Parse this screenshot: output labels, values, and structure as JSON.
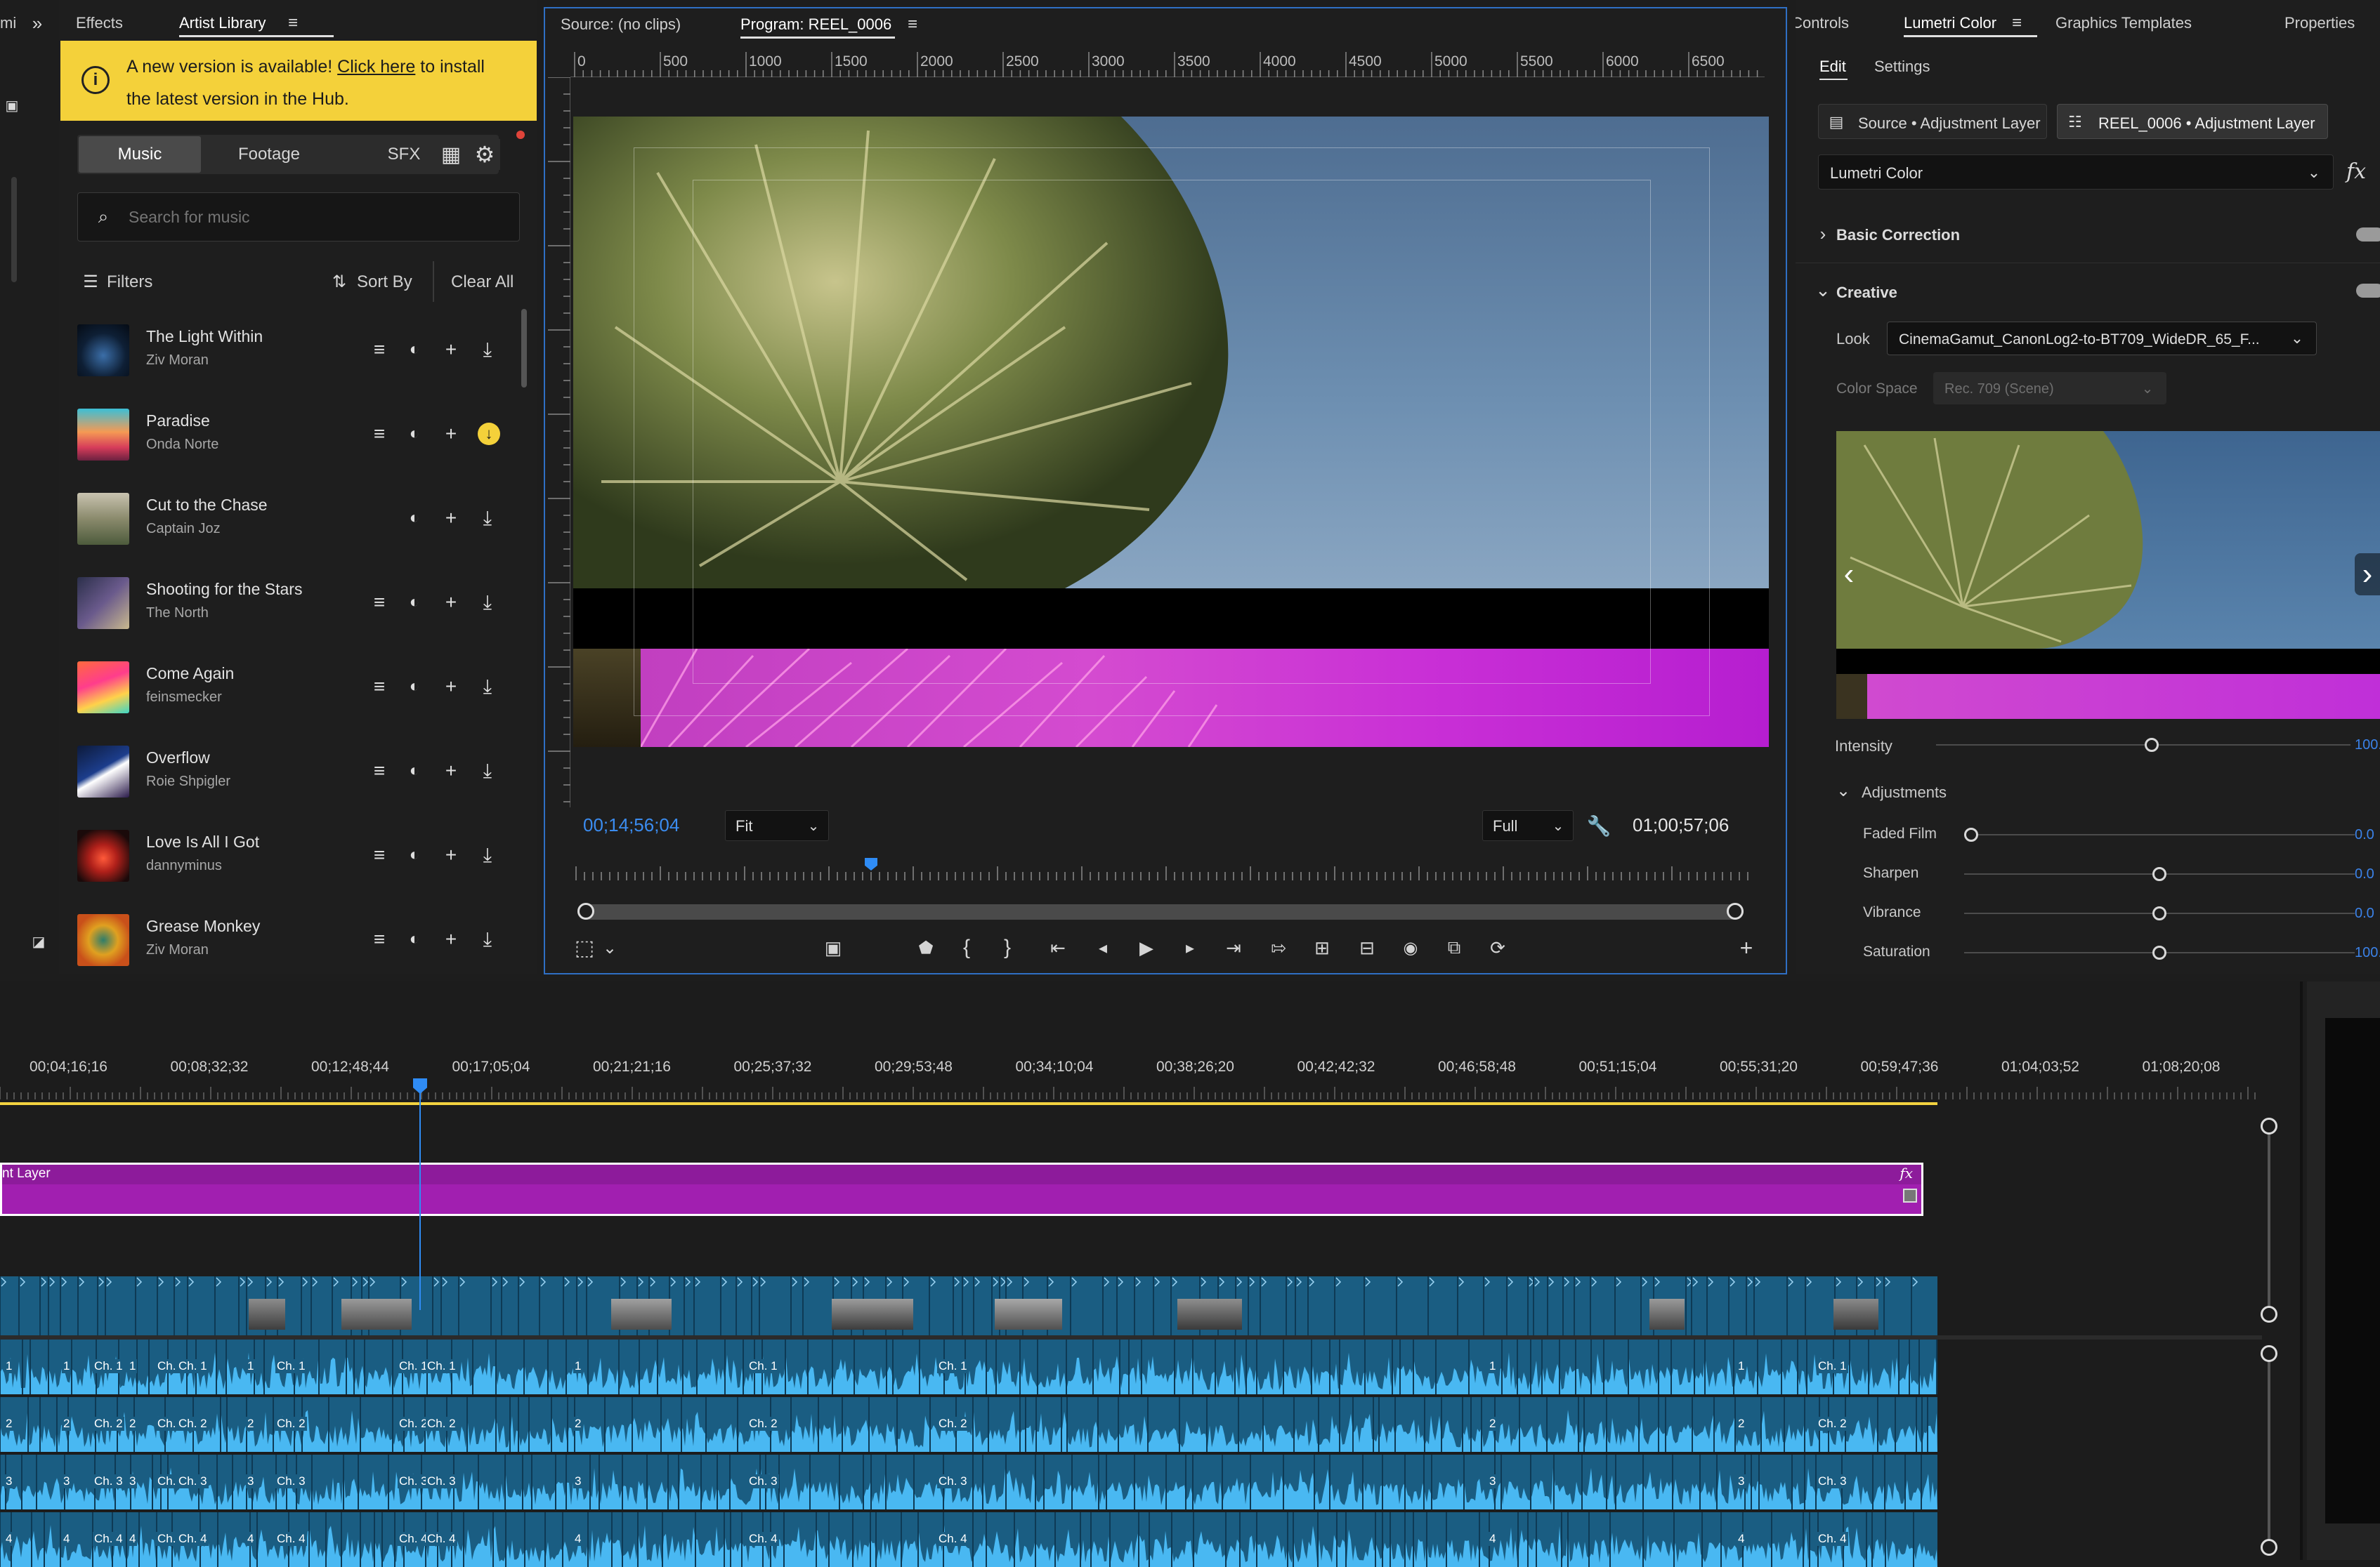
{
  "left_edge": {
    "tab_cut": "mi"
  },
  "artist_panel": {
    "tabs": {
      "effects": "Effects",
      "artist_library": "Artist Library"
    },
    "banner": {
      "text_before": "A new version is available! ",
      "link": "Click here",
      "text_after": " to install",
      "line2": "the latest version in the Hub."
    },
    "categories": [
      "Music",
      "Footage",
      "SFX"
    ],
    "search_placeholder": "Search for music",
    "filters": "Filters",
    "sort_by": "Sort By",
    "clear_all": "Clear All",
    "tracks": [
      {
        "title": "The Light Within",
        "artist": "Ziv Moran"
      },
      {
        "title": "Paradise",
        "artist": "Onda Norte"
      },
      {
        "title": "Cut to the Chase",
        "artist": "Captain Joz"
      },
      {
        "title": "Shooting for the Stars",
        "artist": "The North"
      },
      {
        "title": "Come Again",
        "artist": "feinsmecker"
      },
      {
        "title": "Overflow",
        "artist": "Roie Shpigler"
      },
      {
        "title": "Love Is All I Got",
        "artist": "dannyminus"
      },
      {
        "title": "Grease Monkey",
        "artist": "Ziv Moran"
      }
    ]
  },
  "monitor": {
    "source_tab": "Source: (no clips)",
    "program_tab": "Program: REEL_0006",
    "ruler": [
      "0",
      "500",
      "1000",
      "1500",
      "2000",
      "2500",
      "3000",
      "3500",
      "4000",
      "4500",
      "5000",
      "5500",
      "6000",
      "6500"
    ],
    "current_time": "00;14;56;04",
    "fit_option": "Fit",
    "quality_option": "Full",
    "duration": "01;00;57;06",
    "playhead_fraction": 0.25
  },
  "lumetri": {
    "tabs": {
      "controls": "Controls",
      "lumetri": "Lumetri Color",
      "graphics": "Graphics Templates",
      "properties": "Properties"
    },
    "subtabs": {
      "edit": "Edit",
      "settings": "Settings"
    },
    "source_btn": "Source • Adjustment Layer",
    "reel_btn": "REEL_0006 • Adjustment Layer",
    "effect_select": "Lumetri Color",
    "fx_label": "fx",
    "basic_correction": "Basic Correction",
    "creative": "Creative",
    "look_label": "Look",
    "look_value": "CinemaGamut_CanonLog2-to-BT709_WideDR_65_F...",
    "color_space_label": "Color Space",
    "color_space_value": "Rec. 709 (Scene)",
    "intensity_label": "Intensity",
    "intensity_value": "100.",
    "intensity_fraction": 0.52,
    "adjustments_label": "Adjustments",
    "sliders": [
      {
        "label": "Faded Film",
        "value": "0.0",
        "fraction": 0.0
      },
      {
        "label": "Sharpen",
        "value": "0.0",
        "fraction": 0.5
      },
      {
        "label": "Vibrance",
        "value": "0.0",
        "fraction": 0.5
      },
      {
        "label": "Saturation",
        "value": "100.",
        "fraction": 0.5
      }
    ]
  },
  "timeline": {
    "timecodes": [
      "00;04;16;16",
      "00;08;32;32",
      "00;12;48;44",
      "00;17;05;04",
      "00;21;21;16",
      "00;25;37;32",
      "00;29;53;48",
      "00;34;10;04",
      "00;38;26;20",
      "00;42;42;32",
      "00;46;58;48",
      "00;51;15;04",
      "00;55;31;20",
      "00;59;47;36",
      "01;04;03;52",
      "01;08;20;08"
    ],
    "adjustment_clip_label": "nt Layer",
    "fx_badge": "fx",
    "audio_channels": [
      {
        "labels": [
          "1",
          "1",
          "Ch. 1",
          "1",
          "Ch. 1",
          "Ch. 1",
          "1",
          "Ch. 1",
          "Ch. 1",
          "Ch. 1",
          "1",
          "Ch. 1",
          "Ch. 1",
          "1",
          "1",
          "Ch. 1"
        ]
      },
      {
        "labels": [
          "2",
          "2",
          "Ch. 2",
          "2",
          "Ch. 2",
          "Ch. 2",
          "2",
          "Ch. 2",
          "Ch. 2",
          "Ch. 2",
          "2",
          "Ch. 2",
          "Ch. 2",
          "2",
          "2",
          "Ch. 2"
        ]
      },
      {
        "labels": [
          "3",
          "3",
          "Ch. 3",
          "3",
          "Ch. 3",
          "Ch. 3",
          "3",
          "Ch. 3",
          "Ch. 3",
          "Ch. 3",
          "3",
          "Ch. 3",
          "Ch. 3",
          "3",
          "3",
          "Ch. 3"
        ]
      },
      {
        "labels": [
          "4",
          "4",
          "Ch. 4",
          "4",
          "Ch. 4",
          "Ch. 4",
          "4",
          "Ch. 4",
          "Ch. 4",
          "Ch. 4",
          "4",
          "Ch. 4",
          "Ch. 4",
          "4",
          "4",
          "Ch. 4"
        ]
      }
    ]
  },
  "colors": {
    "accent_blue": "#2f8cf5",
    "banner_yellow": "#f4d13a",
    "clip_purple": "#a11fb0",
    "audio_blue": "#1a5d82",
    "waveform": "#49b8f2",
    "magenta": "#c92fd6"
  }
}
